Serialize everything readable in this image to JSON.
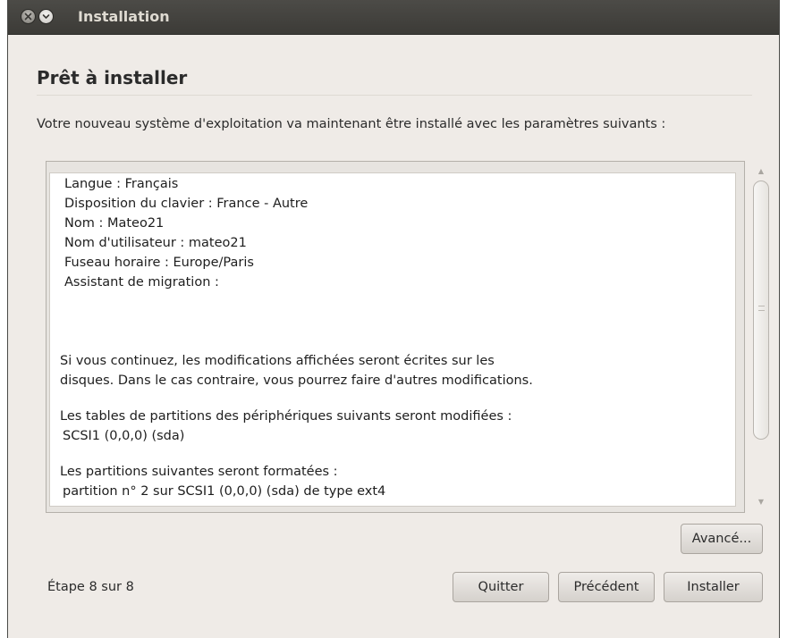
{
  "window": {
    "title": "Installation"
  },
  "page": {
    "heading": "Prêt à installer",
    "intro": "Votre nouveau système d'exploitation va maintenant être installé avec les paramètres suivants :"
  },
  "summary": {
    "settings": [
      "Langue : Français",
      "Disposition du clavier : France - Autre",
      "Nom : Mateo21",
      "Nom d'utilisateur : mateo21",
      "Fuseau horaire : Europe/Paris",
      "Assistant de migration :"
    ],
    "warning_line1": "Si vous continuez, les modifications affichées seront écrites sur les",
    "warning_line2": "disques. Dans le cas contraire, vous pourrez faire d'autres modifications.",
    "partition_tables_heading": "Les tables de partitions des périphériques suivants seront modifiées :",
    "partition_tables_device": "SCSI1 (0,0,0) (sda)",
    "formatted_heading": "Les partitions suivantes seront formatées :",
    "formatted_partition": "partition n° 2 sur SCSI1 (0,0,0) (sda) de type ext4"
  },
  "buttons": {
    "advanced": "Avancé...",
    "quit": "Quitter",
    "previous": "Précédent",
    "install": "Installer"
  },
  "footer": {
    "step": "Étape 8 sur 8"
  }
}
